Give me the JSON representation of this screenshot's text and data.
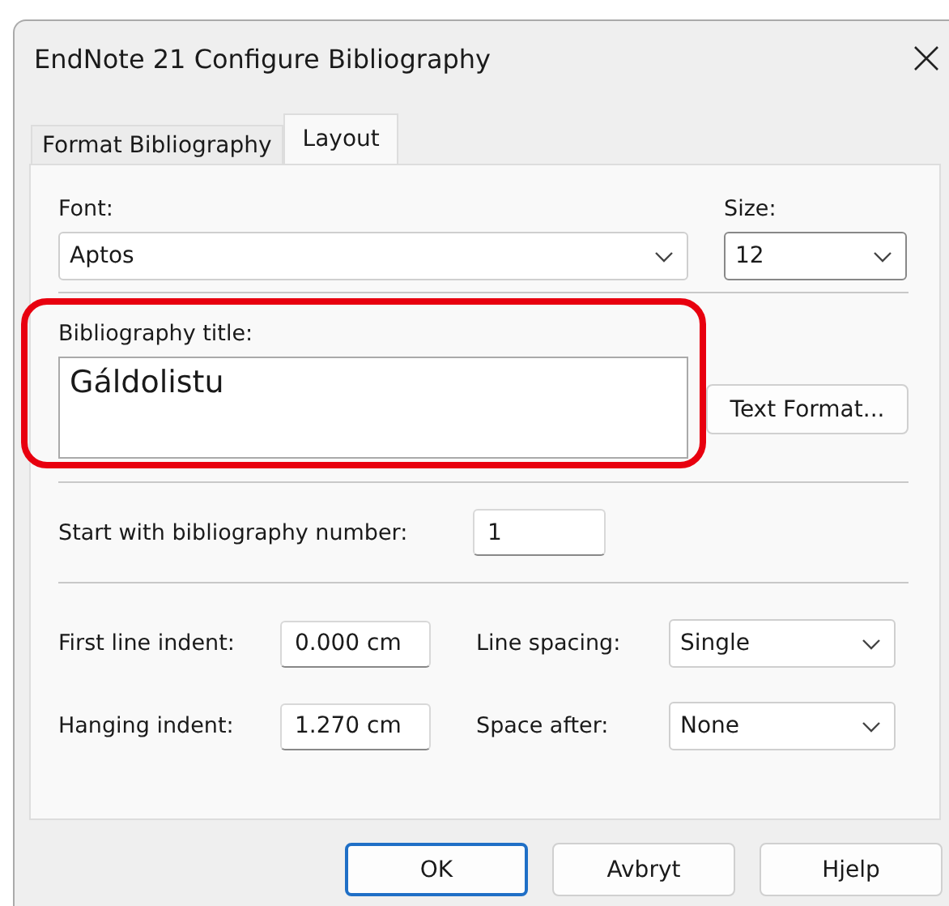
{
  "window": {
    "title": "EndNote 21 Configure Bibliography"
  },
  "tabs": [
    {
      "label": "Format Bibliography",
      "selected": false
    },
    {
      "label": "Layout",
      "selected": true
    }
  ],
  "font": {
    "label": "Font:",
    "value": "Aptos"
  },
  "size": {
    "label": "Size:",
    "value": "12"
  },
  "bibliography_title": {
    "label": "Bibliography title:",
    "value": "Gáldolistu",
    "highlighted": true
  },
  "text_format_button": "Text Format...",
  "start_number": {
    "label": "Start with bibliography number:",
    "value": "1"
  },
  "indents": [
    {
      "label": "First line indent:",
      "value": "0.000 cm"
    },
    {
      "label": "Hanging indent:",
      "value": "1.270 cm"
    }
  ],
  "spacing": [
    {
      "label": "Line spacing:",
      "value": "Single"
    },
    {
      "label": "Space after:",
      "value": "None"
    }
  ],
  "buttons": [
    {
      "label": "OK",
      "default": true
    },
    {
      "label": "Avbryt",
      "default": false
    },
    {
      "label": "Hjelp",
      "default": false
    }
  ]
}
